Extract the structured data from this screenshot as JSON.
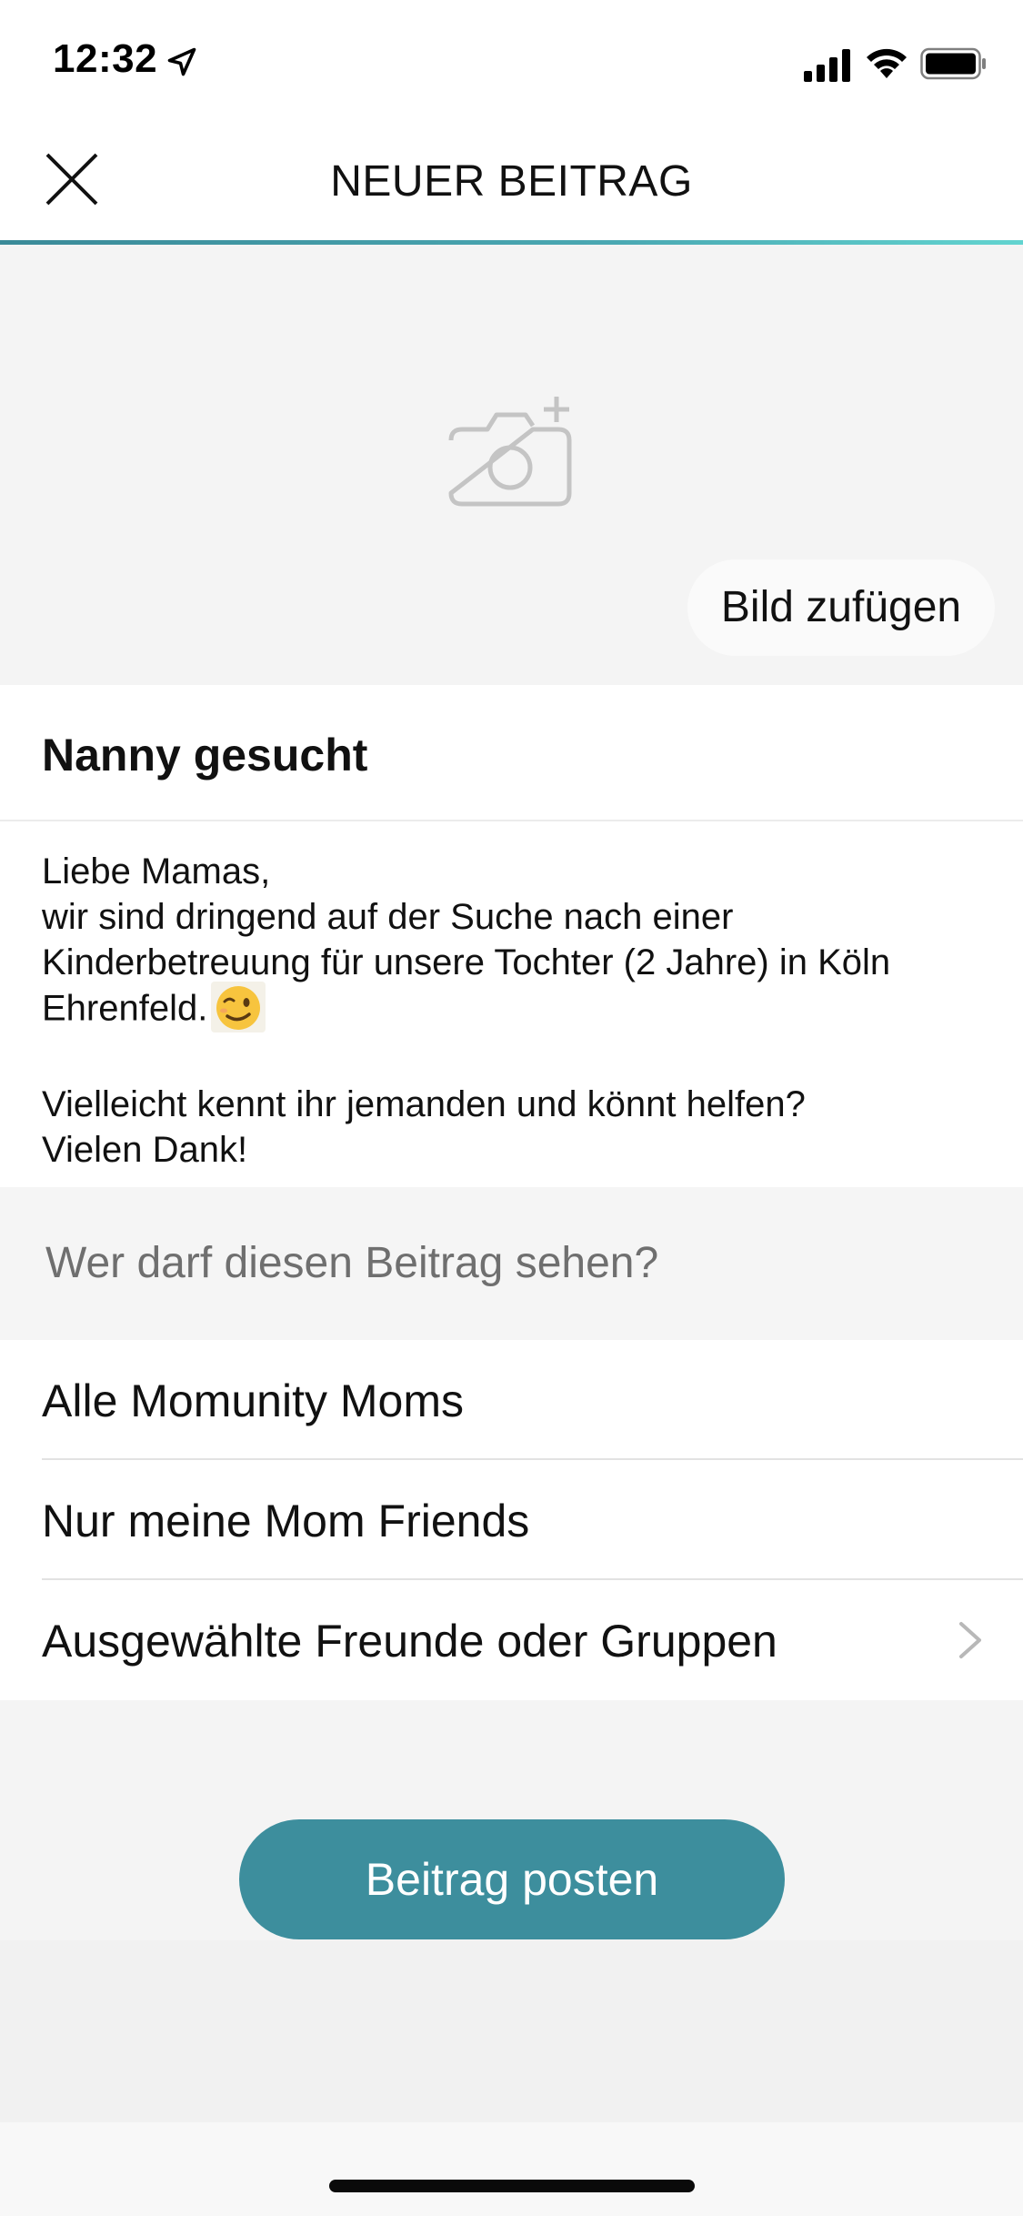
{
  "status_bar": {
    "time": "12:32"
  },
  "nav": {
    "title": "NEUER BEITRAG"
  },
  "image_area": {
    "add_image_label": "Bild zufügen"
  },
  "post": {
    "title": "Nanny gesucht",
    "body_lines": [
      "Liebe Mamas,",
      "wir sind dringend auf der Suche nach einer",
      "Kinderbetreuung für unsere Tochter (2 Jahre) in Köln",
      "Ehrenfeld."
    ],
    "body_lines_2": [
      "Vielleicht kennt ihr jemanden und könnt helfen?",
      "Vielen Dank!"
    ],
    "emoji": "😉"
  },
  "visibility": {
    "question": "Wer darf diesen Beitrag sehen?",
    "options": [
      "Alle Momunity Moms",
      "Nur meine Mom Friends",
      "Ausgewählte Freunde oder Gruppen"
    ]
  },
  "actions": {
    "post_button": "Beitrag posten"
  },
  "colors": {
    "accent": "#3d8e9d",
    "gradient_end": "#62d4d0",
    "background": "#f5f5f5"
  }
}
